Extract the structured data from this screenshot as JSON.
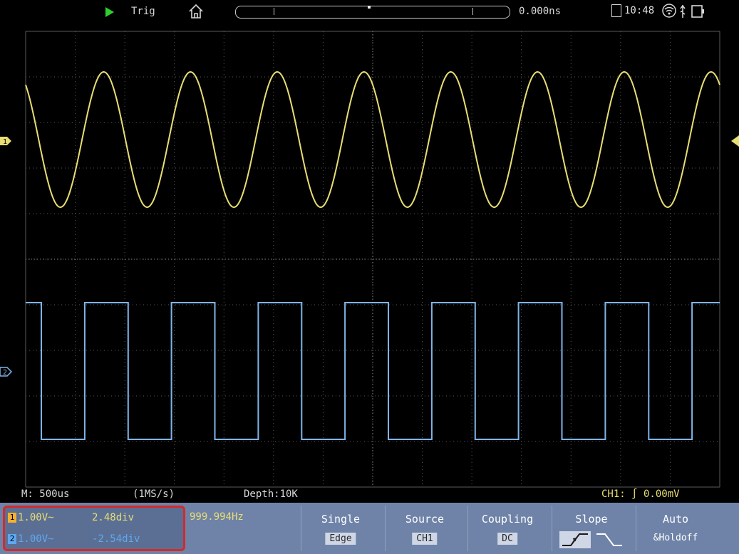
{
  "top_bar": {
    "run_state_icon": "play-icon",
    "trigger_status": "Trig",
    "horizontal_position": "0.000ns",
    "time": "10:48",
    "icons": [
      "home-icon",
      "memory-icon",
      "wifi-icon",
      "usb-icon",
      "battery-icon"
    ],
    "colors": {
      "run": "#2ed02e"
    }
  },
  "waveforms": {
    "ch1": {
      "marker": "1",
      "shape": "sine",
      "color": "#e8de74",
      "cycles_visible": 8
    },
    "ch2": {
      "marker": "2",
      "shape": "square",
      "color": "#7fb4e8",
      "cycles_visible": 8
    }
  },
  "info_bar": {
    "timebase": "M: 500us",
    "sample_rate": "(1MS/s)",
    "depth": "Depth:10K",
    "trigger_readout": "CH1: ∫ 0.00mV"
  },
  "channels": [
    {
      "badge": "1",
      "volts_div": "1.00V~",
      "offset": "2.48div",
      "color": "#e8de74"
    },
    {
      "badge": "2",
      "volts_div": "1.00V~",
      "offset": "-2.54div",
      "color": "#5ea8f0"
    }
  ],
  "frequency": "999.994Hz",
  "menu": {
    "mode": {
      "label": "Single",
      "value": "Edge"
    },
    "source": {
      "label": "Source",
      "value": "CH1"
    },
    "coupling": {
      "label": "Coupling",
      "value": "DC"
    },
    "slope": {
      "label": "Slope",
      "icons": [
        "rising-edge-icon",
        "falling-edge-icon"
      ],
      "selected": "rising"
    },
    "holdoff": {
      "label": "Auto",
      "value": "&Holdoff"
    }
  }
}
